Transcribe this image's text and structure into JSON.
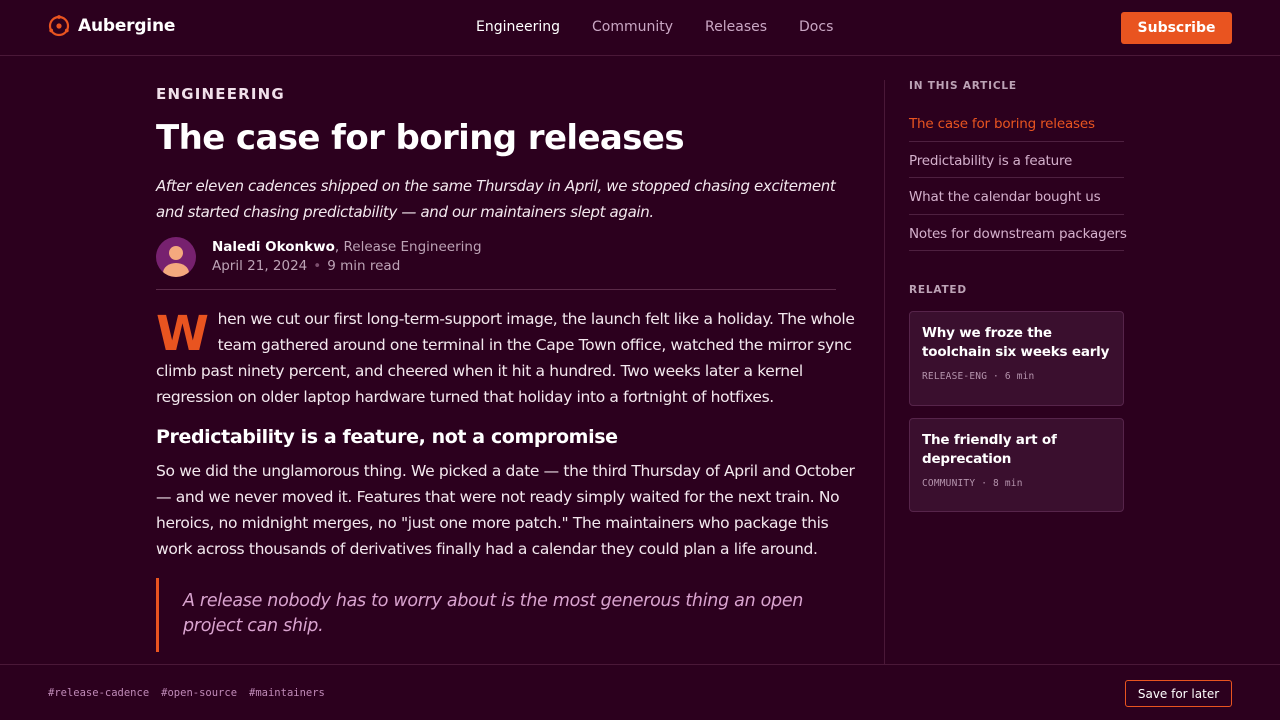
{
  "brand": {
    "name": "Aubergine",
    "accent": "#e95420",
    "background": "#2c001e"
  },
  "header": {
    "nav": [
      "Engineering",
      "Community",
      "Releases",
      "Docs"
    ],
    "active_nav": "Engineering",
    "subscribe_label": "Subscribe"
  },
  "article": {
    "kicker": "ENGINEERING",
    "title": "The case for boring releases",
    "dek": "After eleven cadences shipped on the same Thursday in April, we stopped chasing excitement and started chasing predictability — and our maintainers slept again.",
    "author": {
      "name": "Naledi Okonkwo",
      "separator": ", ",
      "role": "Release Engineering",
      "date": "April 21, 2024",
      "read_time": "9 min read"
    },
    "lead_dropcap": "W",
    "lead_rest": "hen we cut our first long-term-support image, the launch felt like a holiday. The whole team gathered around one terminal in the Cape Town office, watched the mirror sync climb past ninety percent, and cheered when it hit a hundred. Two weeks later a kernel regression on older laptop hardware turned that holiday into a fortnight of hotfixes.",
    "section_heading": "Predictability is a feature, not a compromise",
    "section_body": "So we did the unglamorous thing. We picked a date — the third Thursday of April and October — and we never moved it. Features that were not ready simply waited for the next train. No heroics, no midnight merges, no \"just one more patch.\" The maintainers who package this work across thousands of derivatives finally had a calendar they could plan a life around.",
    "pull_quote": "A release nobody has to worry about is the most generous thing an open project can ship."
  },
  "sidebar": {
    "toc_label": "IN THIS ARTICLE",
    "toc": [
      "The case for boring releases",
      "Predictability is a feature",
      "What the calendar bought us",
      "Notes for downstream packagers"
    ],
    "toc_active_index": 0,
    "related_label": "RELATED",
    "related": [
      {
        "title": "Why we froze the toolchain six weeks early",
        "meta": "RELEASE-ENG · 6 min"
      },
      {
        "title": "The friendly art of deprecation",
        "meta": "COMMUNITY · 8 min"
      }
    ]
  },
  "footer": {
    "tags": [
      "#release-cadence",
      "#open-source",
      "#maintainers"
    ],
    "save_label": "Save for later"
  },
  "icons": {
    "logo": "circle-of-friends-icon",
    "avatar": "person-avatar-icon"
  }
}
